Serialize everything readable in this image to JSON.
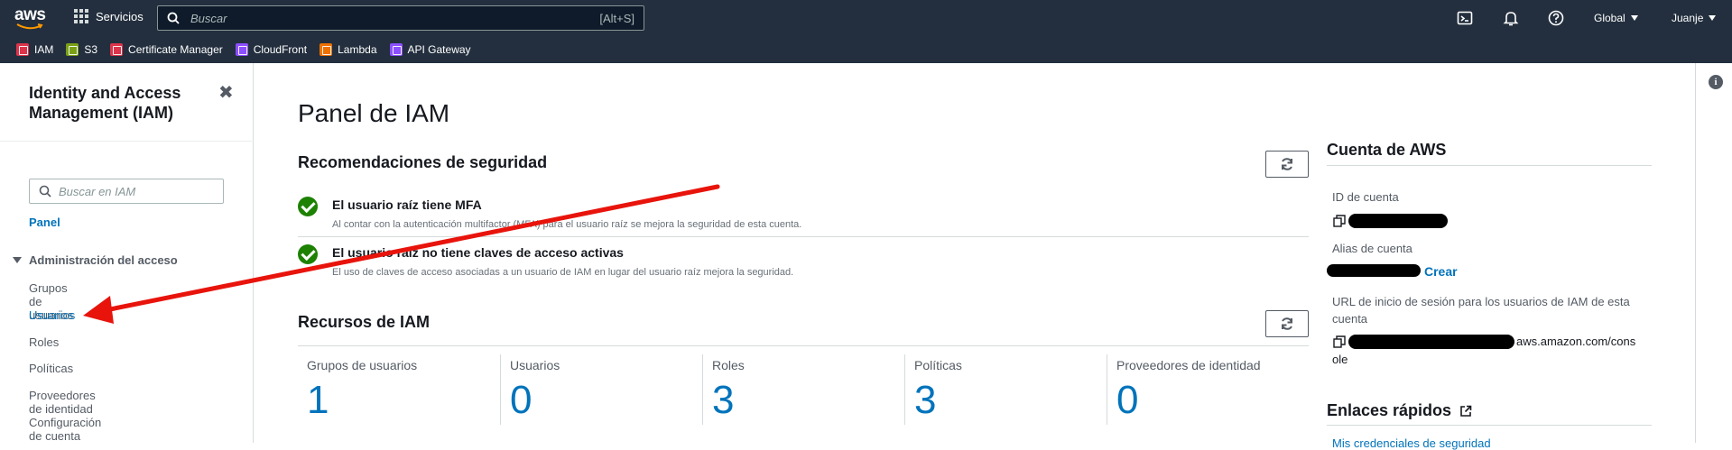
{
  "topnav": {
    "logo_text": "aws",
    "services_label": "Servicios",
    "search_placeholder": "Buscar",
    "search_shortcut": "[Alt+S]",
    "region_label": "Global",
    "user_label": "Juanje"
  },
  "favorites": [
    {
      "label": "IAM",
      "color": "#dd344c"
    },
    {
      "label": "S3",
      "color": "#7aa116"
    },
    {
      "label": "Certificate Manager",
      "color": "#dd344c"
    },
    {
      "label": "CloudFront",
      "color": "#8c4fff"
    },
    {
      "label": "Lambda",
      "color": "#ed7100"
    },
    {
      "label": "API Gateway",
      "color": "#8c4fff"
    }
  ],
  "sidebar": {
    "title": "Identity and Access Management (IAM)",
    "close_glyph": "✖",
    "search_placeholder": "Buscar en IAM",
    "dashboard_link": "Panel",
    "section_label": "Administración del acceso",
    "items": [
      {
        "label": "Grupos de usuarios",
        "active": false
      },
      {
        "label": "Usuarios",
        "active": true
      },
      {
        "label": "Roles",
        "active": false
      },
      {
        "label": "Políticas",
        "active": false
      },
      {
        "label": "Proveedores de identidad",
        "active": false
      },
      {
        "label": "Configuración de cuenta",
        "active": false
      }
    ]
  },
  "main": {
    "title": "Panel de IAM",
    "security": {
      "title": "Recomendaciones de seguridad",
      "items": [
        {
          "title": "El usuario raíz tiene MFA",
          "description": "Al contar con la autenticación multifactor (MFA) para el usuario raíz se mejora la seguridad de esta cuenta."
        },
        {
          "title": "El usuario raíz no tiene claves de acceso activas",
          "description": "El uso de claves de acceso asociadas a un usuario de IAM en lugar del usuario raíz mejora la seguridad."
        }
      ]
    },
    "resources": {
      "title": "Recursos de IAM",
      "items": [
        {
          "label": "Grupos de usuarios",
          "value": "1"
        },
        {
          "label": "Usuarios",
          "value": "0"
        },
        {
          "label": "Roles",
          "value": "3"
        },
        {
          "label": "Políticas",
          "value": "3"
        },
        {
          "label": "Proveedores de identidad",
          "value": "0"
        }
      ]
    }
  },
  "account_panel": {
    "title": "Cuenta de AWS",
    "account_id_label": "ID de cuenta",
    "alias_label": "Alias de cuenta",
    "alias_action": "Crear",
    "signin_url_label": "URL de inicio de sesión para los usuarios de IAM de esta cuenta",
    "signin_url_suffix_1": "aws.amazon.com/cons",
    "signin_url_suffix_2": "ole",
    "quick_links_title": "Enlaces rápidos",
    "quick_link_first": "Mis credenciales de seguridad"
  },
  "colors": {
    "nav_bg": "#232f3e",
    "link_blue": "#0073bb",
    "success_green": "#1d8102",
    "annotation_red": "#e8140c"
  }
}
